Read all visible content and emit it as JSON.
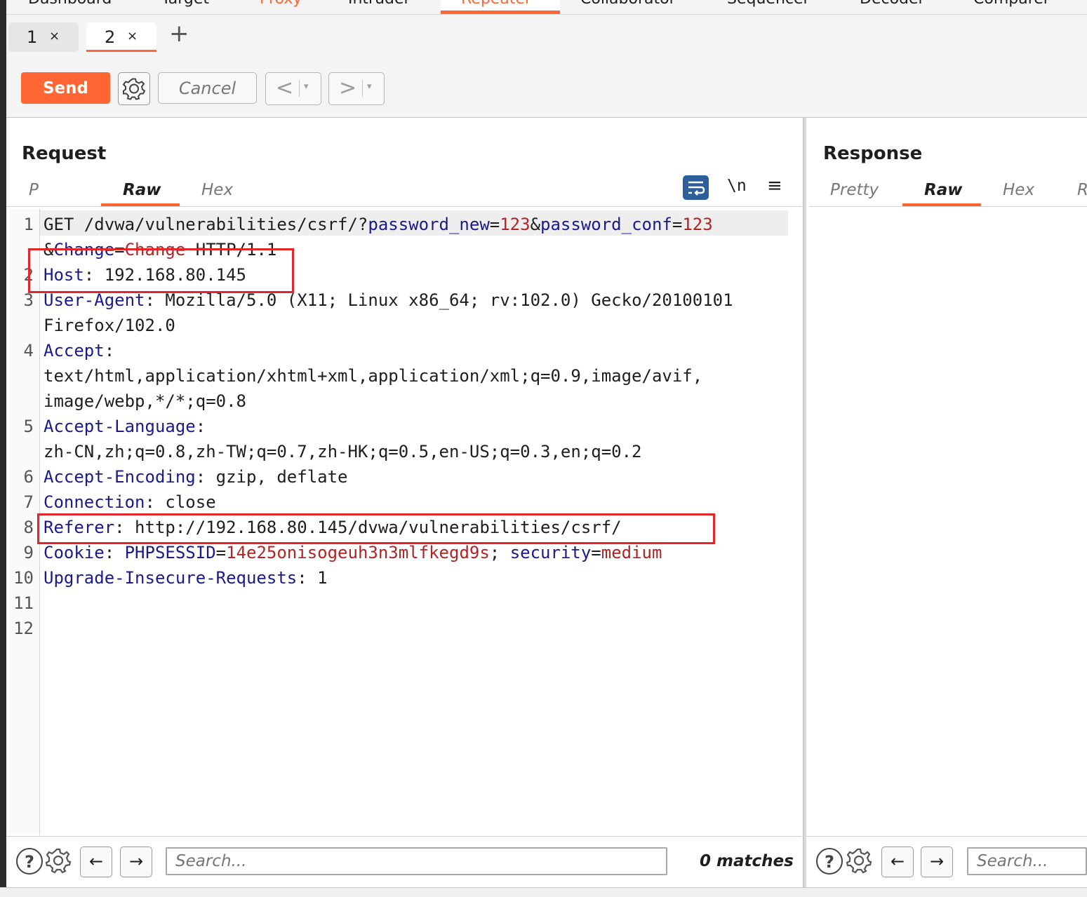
{
  "topnav": {
    "tabs": [
      "Dashboard",
      "Target",
      "Proxy",
      "Intruder",
      "Repeater",
      "Collaborator",
      "Sequencer",
      "Decoder",
      "Comparer"
    ],
    "active": "Repeater",
    "accent": "#ff6633"
  },
  "subtabs": [
    {
      "label": "1",
      "close": "×"
    },
    {
      "label": "2",
      "close": "×",
      "active": true
    }
  ],
  "add_tab": "+",
  "toolbar": {
    "send": "Send",
    "cancel": "Cancel",
    "back": "<",
    "forward": ">",
    "dropdown": "▾"
  },
  "request": {
    "title": "Request",
    "tabs": [
      "P",
      "Raw",
      "Hex"
    ],
    "active_tab": "Raw",
    "newline_toggle": "\\n",
    "menu": "≡"
  },
  "response": {
    "title": "Response",
    "tabs": [
      "Pretty",
      "Raw",
      "Hex",
      "R"
    ],
    "active_tab": "Raw"
  },
  "editor": {
    "line_numbers": [
      "1",
      "2",
      "3",
      "4",
      "5",
      "6",
      "7",
      "8",
      "9",
      "10",
      "11",
      "12"
    ],
    "lines": {
      "l1a_method": "GET /dvwa/vulnerabilities/csrf/?",
      "l1a_k1": "password_new",
      "l1a_eq1": "=",
      "l1a_v1": "123",
      "l1a_amp": "&",
      "l1a_k2": "password_conf",
      "l1a_eq2": "=",
      "l1a_v2": "123",
      "l1b_amp": "&",
      "l1b_k3": "Change",
      "l1b_eq3": "=",
      "l1b_v3": "Change",
      "l1b_proto": " HTTP/1.1",
      "l2_k": "Host",
      "l2_v": ": 192.168.80.145",
      "l3_k": "User-Agent",
      "l3_v": ": Mozilla/5.0 (X11; Linux x86_64; rv:102.0) Gecko/20100101",
      "l3_cont": "Firefox/102.0",
      "l4_k": "Accept",
      "l4_v": ":",
      "l4_cont1": "text/html,application/xhtml+xml,application/xml;q=0.9,image/avif,",
      "l4_cont2": "image/webp,*/*;q=0.8",
      "l5_k": "Accept-Language",
      "l5_v": ":",
      "l5_cont": "zh-CN,zh;q=0.8,zh-TW;q=0.7,zh-HK;q=0.5,en-US;q=0.3,en;q=0.2",
      "l6_k": "Accept-Encoding",
      "l6_v": ": gzip, deflate",
      "l7_k": "Connection",
      "l7_v": ": close",
      "l8_k": "Referer",
      "l8_v": ": http://192.168.80.145/dvwa/vulnerabilities/csrf/",
      "l9_k": "Cookie",
      "l9_sep": ": ",
      "l9_ck1": "PHPSESSID",
      "l9_eq1": "=",
      "l9_cv1": "14e25onisogeuh3n3mlfkegd9s",
      "l9_semi": "; ",
      "l9_ck2": "security",
      "l9_eq2": "=",
      "l9_cv2": "medium",
      "l10_k": "Upgrade-Insecure-Requests",
      "l10_v": ": 1"
    },
    "highlight_color": "#e4262b"
  },
  "search": {
    "request_placeholder": "Search...",
    "response_placeholder": "Search...",
    "matches": "0 matches",
    "help": "?",
    "prev": "←",
    "next": "→"
  }
}
